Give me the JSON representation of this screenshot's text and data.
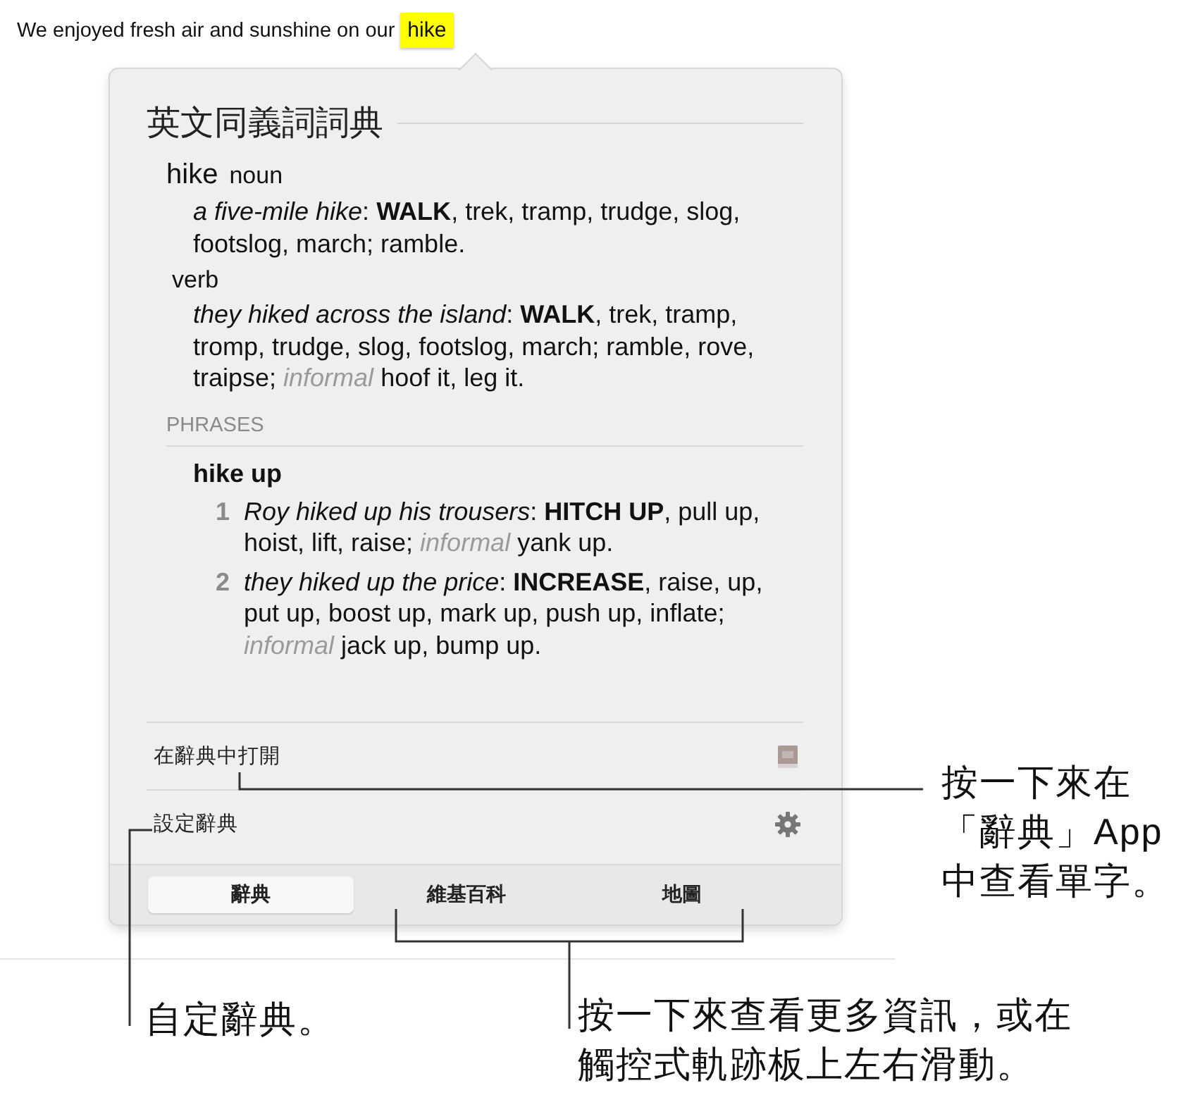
{
  "sentence": {
    "text": "We enjoyed fresh air and sunshine on our",
    "highlight": "hike"
  },
  "popover": {
    "title": "英文同義詞詞典",
    "entry": {
      "headword": "hike",
      "senses": [
        {
          "part_of_speech": "noun",
          "segments": [
            {
              "kind": "example",
              "text": "a five-mile hike"
            },
            {
              "kind": "plain",
              "text": ": "
            },
            {
              "kind": "keyword",
              "text": "WALK"
            },
            {
              "kind": "plain",
              "text": ", trek, tramp, trudge, slog, footslog, march; ramble."
            }
          ]
        },
        {
          "part_of_speech": "verb",
          "segments": [
            {
              "kind": "example",
              "text": "they hiked across the island"
            },
            {
              "kind": "plain",
              "text": ": "
            },
            {
              "kind": "keyword",
              "text": "WALK"
            },
            {
              "kind": "plain",
              "text": ", trek, tramp, tromp, trudge, slog, footslog, march; ramble, rove, traipse; "
            },
            {
              "kind": "register",
              "text": "informal"
            },
            {
              "kind": "plain",
              "text": " hoof it, leg it."
            }
          ]
        }
      ]
    },
    "phrases": {
      "heading": "PHRASES",
      "items": [
        {
          "phrase": "hike up",
          "senses": [
            {
              "number": "1",
              "segments": [
                {
                  "kind": "example",
                  "text": "Roy hiked up his trousers"
                },
                {
                  "kind": "plain",
                  "text": ": "
                },
                {
                  "kind": "keyword",
                  "text": "HITCH UP"
                },
                {
                  "kind": "plain",
                  "text": ", pull up, hoist, lift, raise; "
                },
                {
                  "kind": "register",
                  "text": "informal"
                },
                {
                  "kind": "plain",
                  "text": " yank up."
                }
              ]
            },
            {
              "number": "2",
              "segments": [
                {
                  "kind": "example",
                  "text": "they hiked up the price"
                },
                {
                  "kind": "plain",
                  "text": ": "
                },
                {
                  "kind": "keyword",
                  "text": "INCREASE"
                },
                {
                  "kind": "plain",
                  "text": ", raise, up, put up, boost up, mark up, push up, inflate; "
                },
                {
                  "kind": "register",
                  "text": "informal"
                },
                {
                  "kind": "plain",
                  "text": " jack up, bump up."
                }
              ]
            }
          ]
        }
      ]
    },
    "actions": [
      {
        "label": "在辭典中打開",
        "kind": "open"
      },
      {
        "label": "設定辭典",
        "kind": "settings"
      }
    ],
    "tabs": [
      {
        "label": "辭典",
        "selected": true
      },
      {
        "label": "維基百科",
        "selected": false
      },
      {
        "label": "地圖",
        "selected": false
      }
    ]
  },
  "callouts": [
    {
      "kind": "open",
      "text": "按一下來在「辭典」App中查看單字。"
    },
    {
      "kind": "settings",
      "text": "自定辭典。"
    },
    {
      "kind": "tabs",
      "text": "按一下來查看更多資訊，或在觸控式軌跡板上左右滑動。"
    }
  ]
}
